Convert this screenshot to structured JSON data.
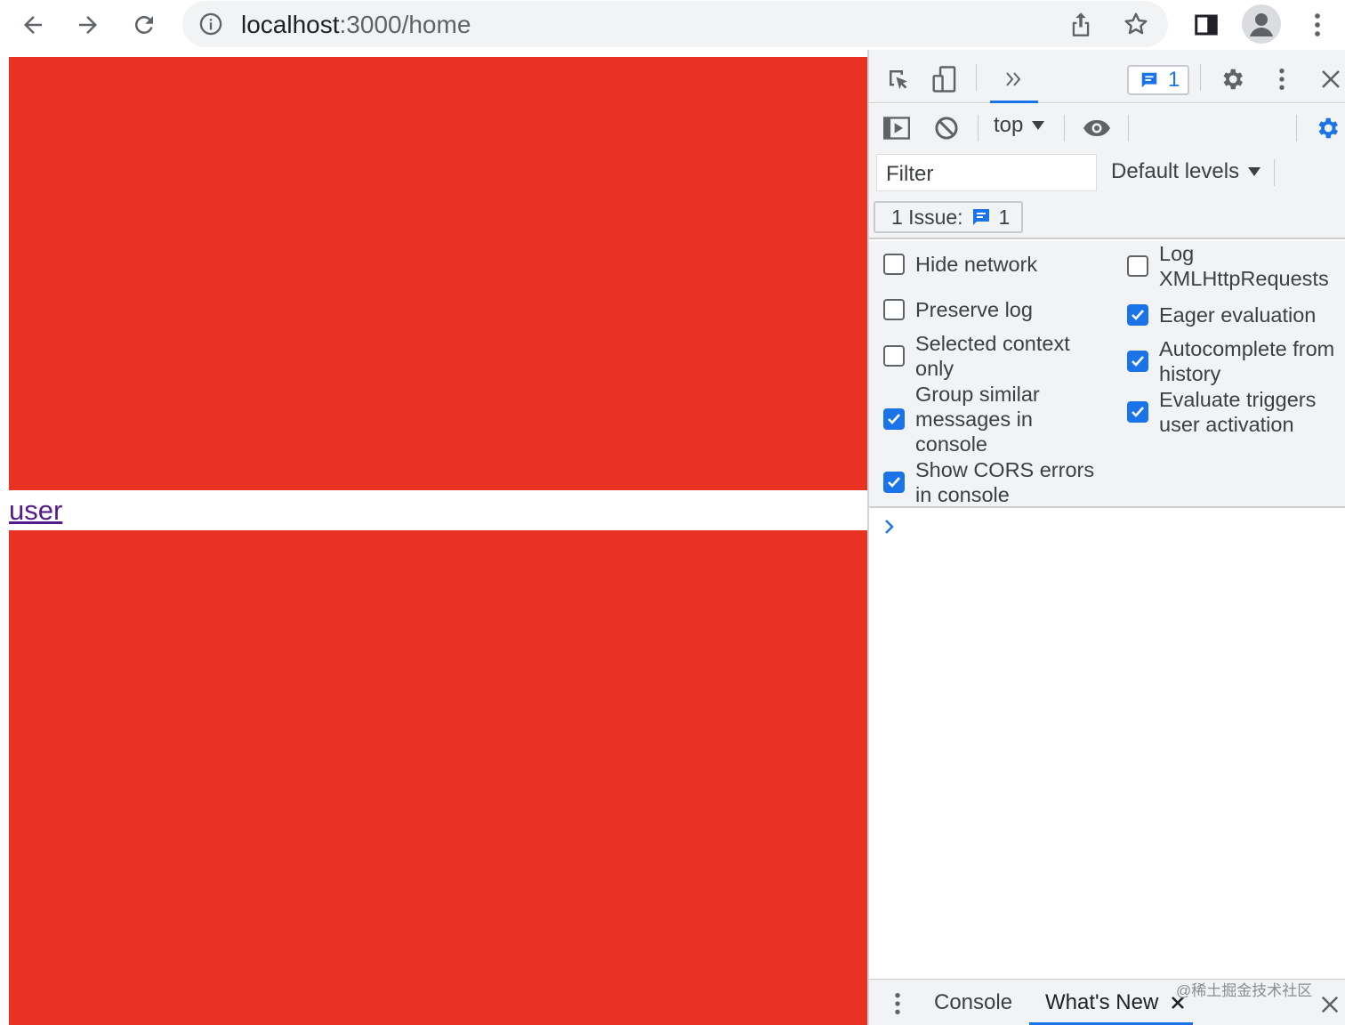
{
  "browser": {
    "url_host": "localhost",
    "url_path": ":3000/home"
  },
  "page": {
    "link_text": "user",
    "box_color": "#e83224"
  },
  "devtools": {
    "issues_badge_count": "1",
    "context_selector": "top",
    "filter_placeholder": "Filter",
    "levels_label": "Default levels",
    "issue_label": "1 Issue:",
    "issue_count": "1",
    "settings_left": [
      {
        "label": "Hide network",
        "checked": false
      },
      {
        "label": "Preserve log",
        "checked": false
      },
      {
        "label": "Selected context only",
        "checked": false
      },
      {
        "label": "Group similar messages in console",
        "checked": true
      },
      {
        "label": "Show CORS errors in console",
        "checked": true
      }
    ],
    "settings_right": [
      {
        "label": "Log XMLHttpRequests",
        "checked": false
      },
      {
        "label": "Eager evaluation",
        "checked": true
      },
      {
        "label": "Autocomplete from history",
        "checked": true
      },
      {
        "label": "Evaluate triggers user activation",
        "checked": true
      }
    ],
    "drawer_tabs": [
      "Console",
      "What's New"
    ],
    "watermark": "@稀土掘金技术社区",
    "accent": "#1a73e8"
  }
}
